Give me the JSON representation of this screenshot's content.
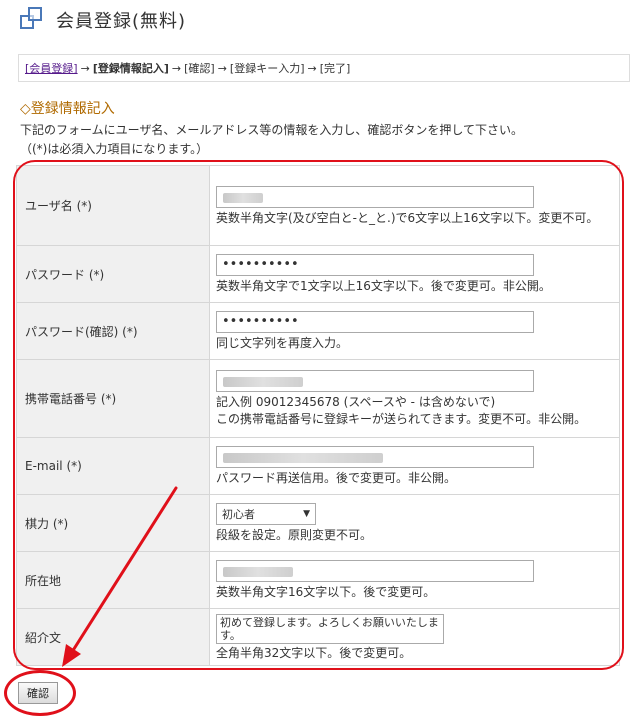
{
  "header": {
    "title": "会員登録(無料)"
  },
  "breadcrumb": {
    "step1": "[会員登録]",
    "step2": "[登録情報記入]",
    "step3": "[確認]",
    "step4": "[登録キー入力]",
    "step5": "[完了]",
    "arrow": "→"
  },
  "section": {
    "title": "◇登録情報記入",
    "intro1": "下記のフォームにユーザ名、メールアドレス等の情報を入力し、確認ボタンを押して下さい。",
    "intro2": "（(*)は必須入力項目になります。）"
  },
  "form": {
    "username": {
      "label": "ユーザ名 (*)",
      "help": "英数半角文字(及び空白と-と_と.)で6文字以上16文字以下。変更不可。"
    },
    "password": {
      "label": "パスワード (*)",
      "value": "••••••••••",
      "help": "英数半角文字で1文字以上16文字以下。後で変更可。非公開。"
    },
    "password_confirm": {
      "label": "パスワード(確認) (*)",
      "value": "••••••••••",
      "help": "同じ文字列を再度入力。"
    },
    "phone": {
      "label": "携帯電話番号 (*)",
      "help1": "記入例 09012345678 (スペースや - は含めないで)",
      "help2": "この携帯電話番号に登録キーが送られてきます。変更不可。非公開。"
    },
    "email": {
      "label": "E-mail (*)",
      "help": "パスワード再送信用。後で変更可。非公開。"
    },
    "strength": {
      "label": "棋力 (*)",
      "selected": "初心者",
      "help": "段級を設定。原則変更不可。"
    },
    "address": {
      "label": "所在地",
      "help": "英数半角文字16文字以下。後で変更可。"
    },
    "intro_text": {
      "label": "紹介文",
      "value": "初めて登録します。よろしくお願いいたします。",
      "help": "全角半角32文字以下。後で変更可。"
    }
  },
  "actions": {
    "confirm_label": "確認"
  },
  "colors": {
    "annotation": "#e0101a",
    "section_title": "#b06a00",
    "icon": "#4a78b8"
  },
  "icons": {
    "logo": "overlapping-squares-icon",
    "select": "chevron-down-icon"
  }
}
